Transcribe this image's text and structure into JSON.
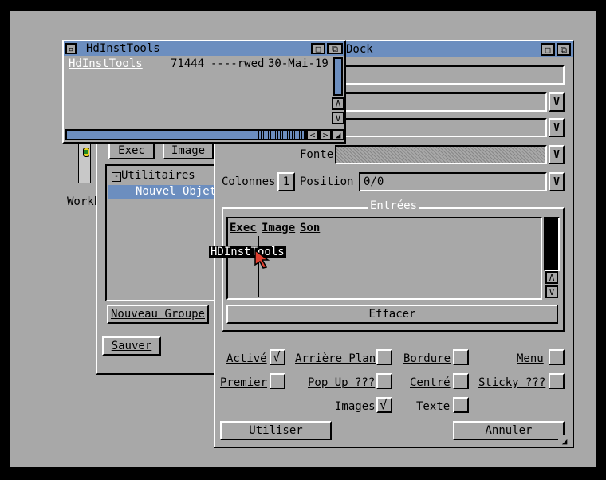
{
  "listwin": {
    "title": "HdInstTools",
    "row": {
      "name": "HdInstTools",
      "size": "71444",
      "flags": "----rwed",
      "date": "30-Mai-19"
    }
  },
  "backwin": {
    "tabs": [
      "Exec",
      "Image"
    ],
    "tree": {
      "group": "Utilitaires",
      "item": "Nouvel Objet",
      "group_marker": "-"
    },
    "new_group_btn": "Nouveau Groupe",
    "save_btn": "Sauver"
  },
  "desktop": {
    "icon_label": "Workb"
  },
  "dock": {
    "title": "Dock",
    "font_label": "Fonte",
    "columns_label": "Colonnes",
    "columns_value": "1",
    "position_label": "Position",
    "position_value": "0/0",
    "entries_label": "Entrées",
    "entries_headers": [
      "Exec",
      "Image",
      "Son"
    ],
    "drag_label": "HDInstTools",
    "clear_btn": "Effacer",
    "checkboxes": [
      {
        "label": "Activé",
        "checked": true
      },
      {
        "label": "Arrière Plan",
        "checked": false
      },
      {
        "label": "Bordure",
        "checked": false
      },
      {
        "label": "Menu",
        "checked": false
      },
      {
        "label": "Premier",
        "checked": false
      },
      {
        "label": "Pop Up ???",
        "checked": false
      },
      {
        "label": "Centré",
        "checked": false
      },
      {
        "label": "Sticky ???",
        "checked": false
      },
      {
        "label": "Images",
        "checked": true
      },
      {
        "label": "Texte",
        "checked": false
      }
    ],
    "use_btn": "Utiliser",
    "cancel_btn": "Annuler",
    "check_mark": "√"
  },
  "colors": {
    "screen": "#a8a8a8",
    "titlebar": "#6c8ebf",
    "selection": "#6c8ebf"
  },
  "icons": [
    "close-icon",
    "depth-icon",
    "zoom-icon",
    "scroll-up-icon",
    "scroll-down-icon",
    "scroll-left-icon",
    "scroll-right-icon",
    "resize-icon",
    "cycle-icon",
    "mouse-pointer-icon",
    "drawer-icon"
  ]
}
